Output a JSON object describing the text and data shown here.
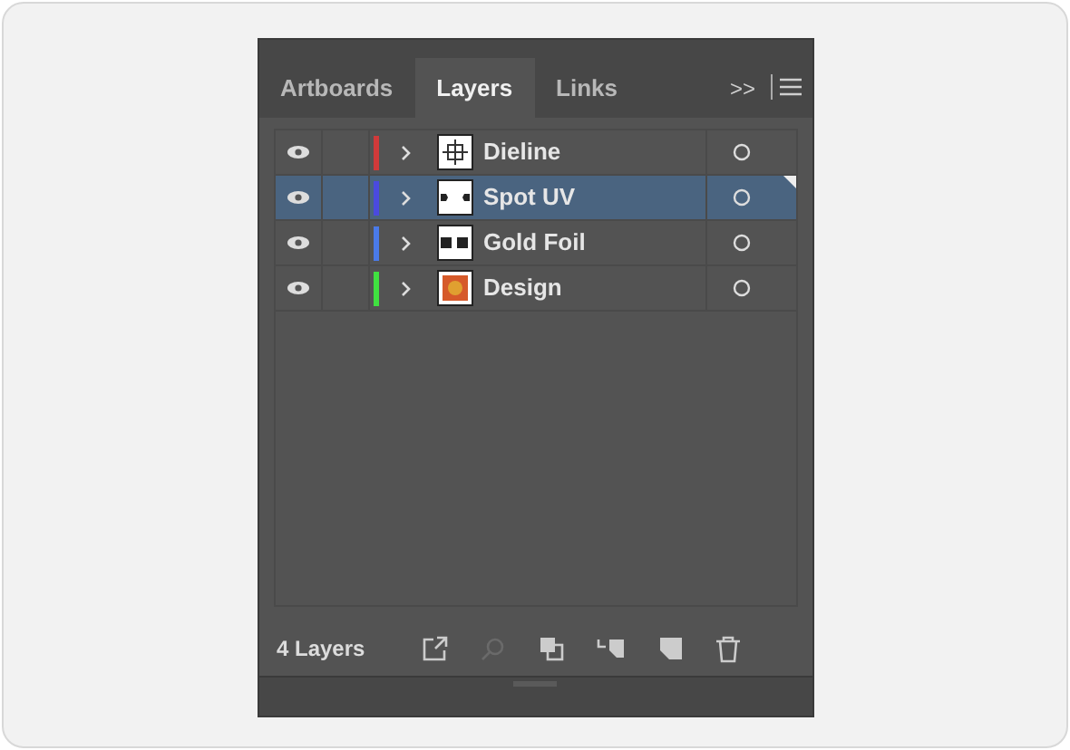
{
  "tabs": [
    {
      "label": "Artboards",
      "selected": false
    },
    {
      "label": "Layers",
      "selected": true
    },
    {
      "label": "Links",
      "selected": false
    }
  ],
  "tab_overflow": ">>",
  "layers": [
    {
      "name": "Dieline",
      "visible": true,
      "selected": false,
      "color": "#d03a3a",
      "kind": "outline"
    },
    {
      "name": "Spot UV",
      "visible": true,
      "selected": true,
      "color": "#4a4ae0",
      "kind": "cutout"
    },
    {
      "name": "Gold Foil",
      "visible": true,
      "selected": false,
      "color": "#4a7ae8",
      "kind": "marks"
    },
    {
      "name": "Design",
      "visible": true,
      "selected": false,
      "color": "#40e040",
      "kind": "artwork"
    }
  ],
  "footer": {
    "count": "4 Layers"
  }
}
